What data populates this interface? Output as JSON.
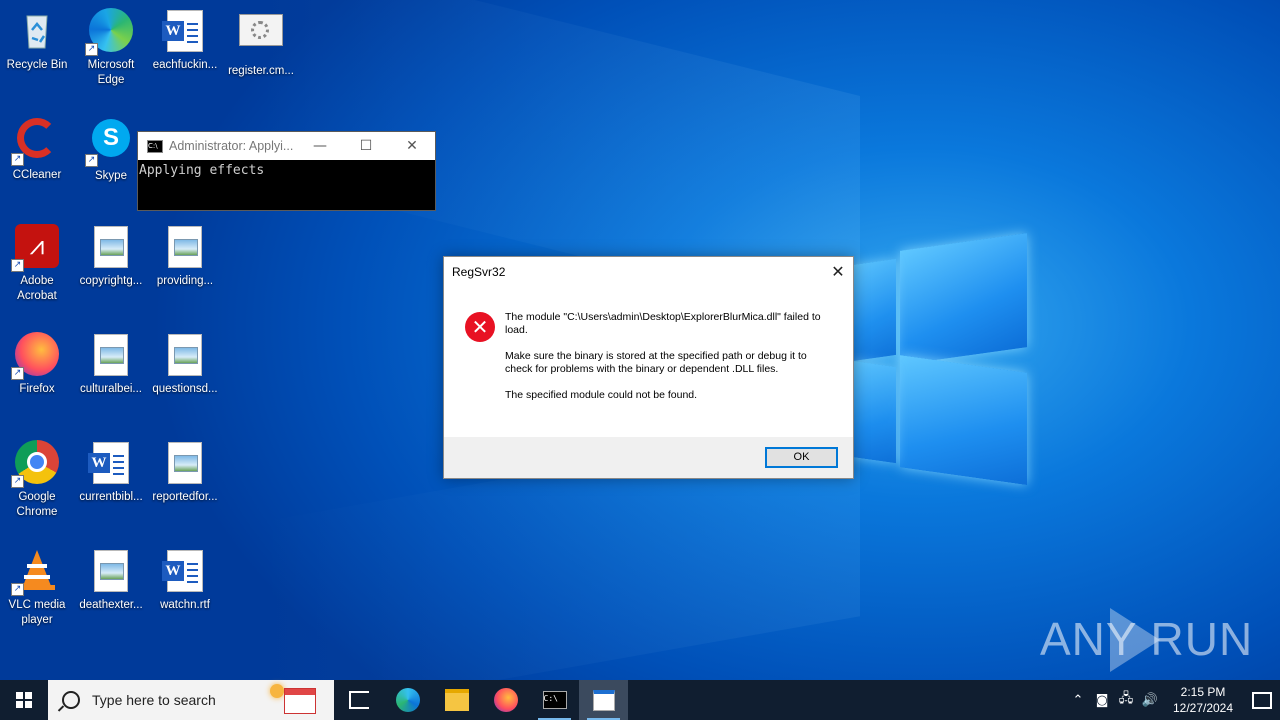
{
  "desktop": {
    "icons": [
      {
        "label": "Recycle Bin",
        "icon": "recycle-bin-icon"
      },
      {
        "label": "Microsoft Edge",
        "icon": "edge-icon"
      },
      {
        "label": "eachfuckin...",
        "icon": "word-document-icon"
      },
      {
        "label": "register.cm...",
        "icon": "cmd-script-icon"
      },
      {
        "label": "CCleaner",
        "icon": "ccleaner-icon"
      },
      {
        "label": "Skype",
        "icon": "skype-icon"
      },
      {
        "label": "Adobe Acrobat",
        "icon": "acrobat-icon"
      },
      {
        "label": "copyrightg...",
        "icon": "image-file-icon"
      },
      {
        "label": "providing...",
        "icon": "image-file-icon"
      },
      {
        "label": "Firefox",
        "icon": "firefox-icon"
      },
      {
        "label": "culturalbei...",
        "icon": "image-file-icon"
      },
      {
        "label": "questionsd...",
        "icon": "image-file-icon"
      },
      {
        "label": "Google Chrome",
        "icon": "chrome-icon"
      },
      {
        "label": "currentbibl...",
        "icon": "word-document-icon"
      },
      {
        "label": "reportedfor...",
        "icon": "image-file-icon"
      },
      {
        "label": "VLC media player",
        "icon": "vlc-icon"
      },
      {
        "label": "deathexter...",
        "icon": "image-file-icon"
      },
      {
        "label": "watchn.rtf",
        "icon": "word-document-icon"
      }
    ]
  },
  "cmd_window": {
    "title": "Administrator: Applyi...",
    "output": "Applying effects"
  },
  "dialog": {
    "title": "RegSvr32",
    "message_1": "The module \"C:\\Users\\admin\\Desktop\\ExplorerBlurMica.dll\" failed to load.",
    "message_2": "Make sure the binary is stored at the specified path or debug it to check for problems with the binary or dependent .DLL files.",
    "message_3": "The specified module could not be found.",
    "ok_label": "OK"
  },
  "watermark": {
    "text": "ANY RUN"
  },
  "taskbar": {
    "search_placeholder": "Type here to search",
    "time": "2:15 PM",
    "date": "12/27/2024"
  }
}
